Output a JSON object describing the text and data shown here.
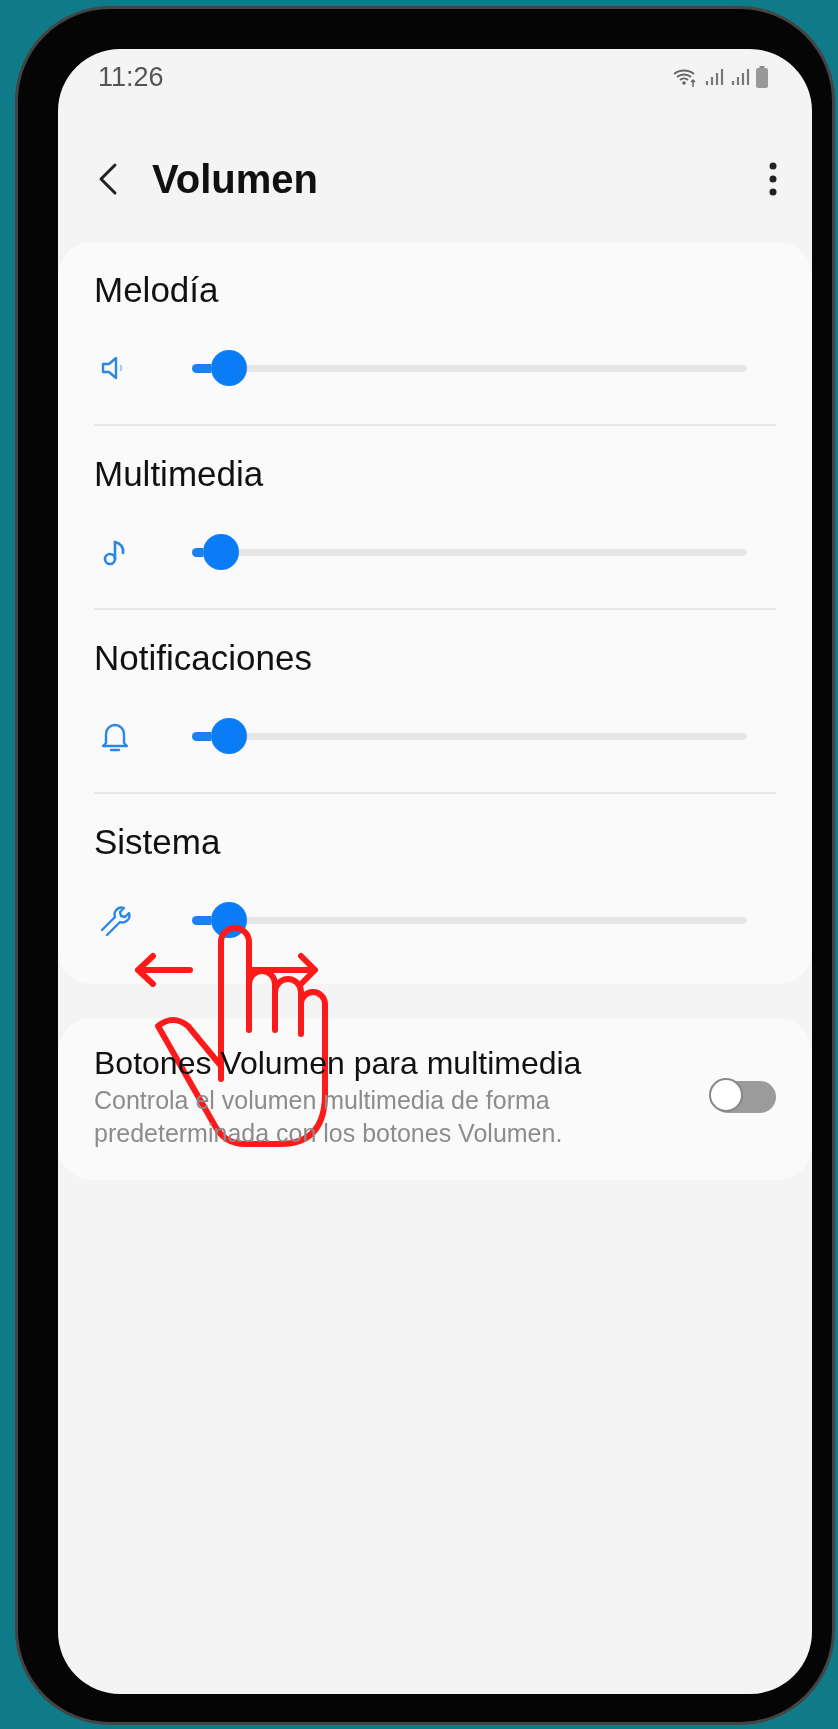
{
  "status_bar": {
    "time": "11:26"
  },
  "header": {
    "title": "Volumen"
  },
  "sliders": [
    {
      "label": "Melodía",
      "kind": "ringtone",
      "level": 0.067
    },
    {
      "label": "Multimedia",
      "kind": "media",
      "level": 0.052
    },
    {
      "label": "Notificaciones",
      "kind": "notification",
      "level": 0.067
    },
    {
      "label": "Sistema",
      "kind": "system",
      "level": 0.067
    }
  ],
  "settings": [
    {
      "title": "Botones Volumen para multimedia",
      "description": "Controla el volumen multimedia de forma predeterminada con los botones Volumen.",
      "checked": false
    }
  ]
}
